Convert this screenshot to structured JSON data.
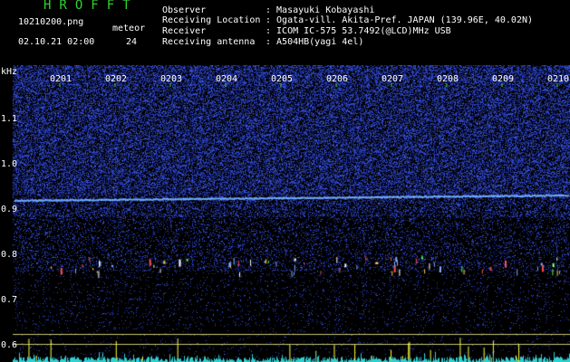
{
  "header": {
    "app_title": "HROFFT",
    "file_name": "10210200.png",
    "meteor_label": "meteor",
    "timestamp": "02.10.21 02:00",
    "meteor_count": "24",
    "observer_label": "Observer",
    "observer_value": ": Masayuki Kobayashi",
    "location_label": "Receiving Location",
    "location_value": ": Ogata-vill. Akita-Pref. JAPAN (139.96E, 40.02N)",
    "receiver_label": "Receiver",
    "receiver_value": ": ICOM IC-575 53.7492(@LCD)MHz USB",
    "antenna_label": "Receiving antenna",
    "antenna_value": ": A504HB(yagi 4el)"
  },
  "axis": {
    "unit": "kHz",
    "freq_ticks": [
      {
        "label": "1.1",
        "value": 1.1
      },
      {
        "label": "1.0",
        "value": 1.0
      },
      {
        "label": "0.9",
        "value": 0.9
      },
      {
        "label": "0.8",
        "value": 0.8
      },
      {
        "label": "0.7",
        "value": 0.7
      },
      {
        "label": "0.6",
        "value": 0.6
      }
    ],
    "time_ticks": [
      "0201",
      "0202",
      "0203",
      "0204",
      "0205",
      "0206",
      "0207",
      "0208",
      "0209",
      "0210"
    ]
  },
  "colors": {
    "background": "#000000",
    "noise": "#2a3aa0",
    "carrier": "#6fa8ff",
    "tick_green": "#2fd22f",
    "text_white": "#ffffff",
    "meteor_bar": "#ffff40",
    "histogram": "#30d0d0"
  }
}
